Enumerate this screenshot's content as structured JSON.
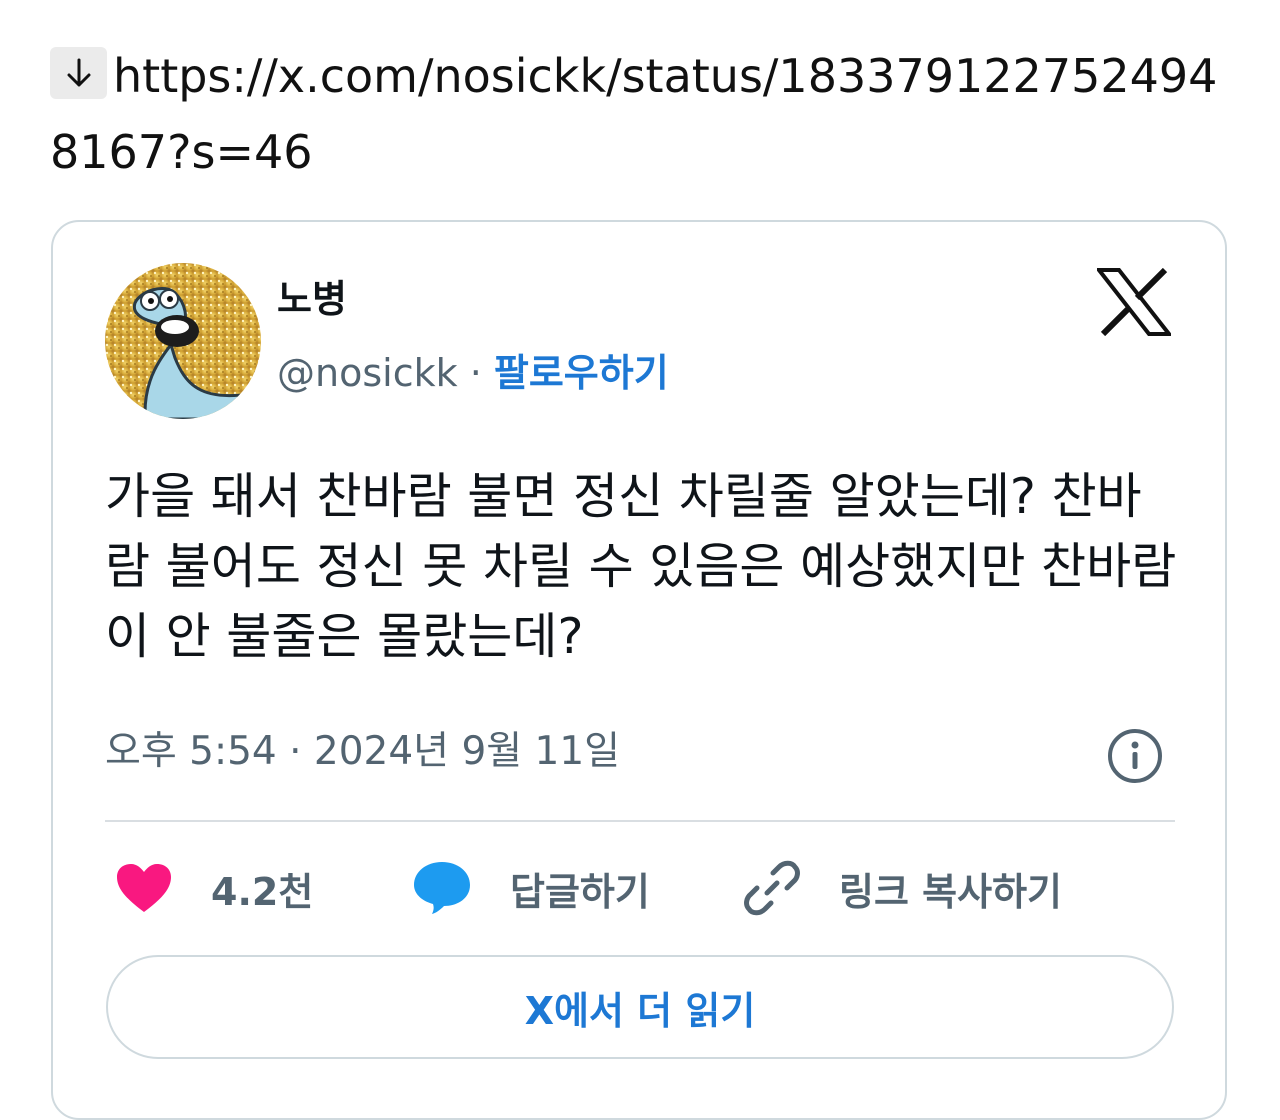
{
  "link": {
    "icon": "download-arrow-icon",
    "url": "https://x.com/nosickk/status/1833791227524948167?s=46"
  },
  "tweet": {
    "display_name": "노병",
    "handle": "@nosickk",
    "separator": "·",
    "follow_label": "팔로우하기",
    "text": "가을 돼서 찬바람 불면 정신 차릴줄 알았는데? 찬바람 불어도 정신 못 차릴 수 있음은 예상했지만 찬바람이 안 불줄은 몰랐는데?",
    "timestamp": "오후 5:54 · 2024년 9월 11일"
  },
  "actions": {
    "like_count": "4.2천",
    "reply_label": "답글하기",
    "copy_link_label": "링크 복사하기"
  },
  "read_more_label": "X에서 더 읽기",
  "colors": {
    "accent_blue": "#1d78d4",
    "like_pink": "#f91880",
    "reply_blue": "#1d9bf0",
    "muted_text": "#536471",
    "border": "#cfd9de"
  }
}
